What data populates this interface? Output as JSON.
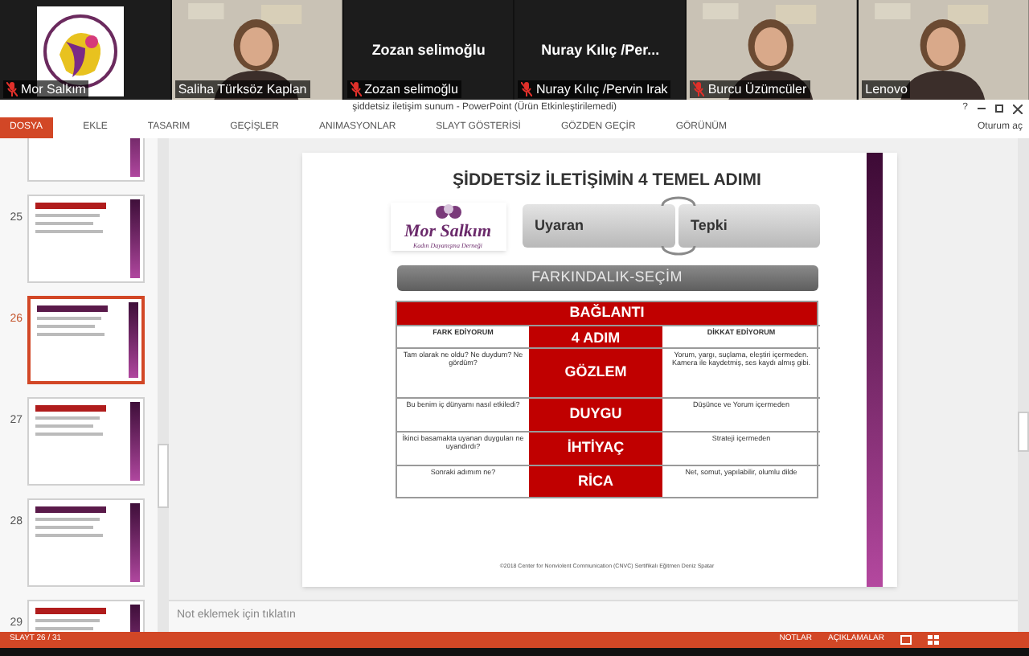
{
  "participants": [
    {
      "name": "Mor Salkım",
      "kind": "logo",
      "muted": true
    },
    {
      "name": "Saliha Türksöz Kaplan",
      "kind": "video",
      "muted": false
    },
    {
      "name": "Zozan selimoğlu",
      "kind": "name",
      "center_name": "Zozan selimoğlu",
      "muted": true
    },
    {
      "name": "Nuray Kılıç /Pervin Irak",
      "kind": "name",
      "center_name": "Nuray  Kılıç  /Per...",
      "muted": true
    },
    {
      "name": "Burcu Üzümcüler",
      "kind": "video",
      "muted": true
    },
    {
      "name": "Lenovo",
      "kind": "video",
      "muted": false
    }
  ],
  "window": {
    "title": "şiddetsiz iletişim sunum - PowerPoint (Ürün Etkinleştirilemedi)",
    "help": "?",
    "sign_in": "Oturum aç"
  },
  "ribbon_tabs": [
    {
      "label": "DOSYA",
      "selected": true
    },
    {
      "label": "EKLE",
      "selected": false
    },
    {
      "label": "TASARIM",
      "selected": false
    },
    {
      "label": "GEÇİŞLER",
      "selected": false
    },
    {
      "label": "ANIMASYONLAR",
      "selected": false
    },
    {
      "label": "SLAYT GÖSTERİSİ",
      "selected": false
    },
    {
      "label": "GÖZDEN GEÇİR",
      "selected": false
    },
    {
      "label": "GÖRÜNÜM",
      "selected": false
    }
  ],
  "thumbnails": [
    {
      "selected": false
    },
    {
      "number": "25",
      "selected": false
    },
    {
      "number": "26",
      "selected": true
    },
    {
      "number": "27",
      "selected": false
    },
    {
      "number": "28",
      "selected": false
    },
    {
      "number": "29",
      "selected": false
    }
  ],
  "slide": {
    "title": "ŞİDDETSİZ İLETİŞİMİN 4 TEMEL ADIMI",
    "logo_name": "Mor Salkım",
    "logo_subtitle": "Kadın Dayanışma Derneği",
    "stimulus": "Uyaran",
    "response": "Tepki",
    "banner": "FARKINDALIK-SEÇİM",
    "table": {
      "header": "BAĞLANTI",
      "columns": [
        "FARK EDİYORUM",
        "4 ADIM",
        "DİKKAT EDİYORUM"
      ],
      "rows": [
        [
          "Tam olarak ne oldu? Ne duydum? Ne gördüm?",
          "GÖZLEM",
          "Yorum, yargı, suçlama, eleştiri içermeden. Kamera ile kaydetmiş, ses kaydı almış gibi."
        ],
        [
          "Bu benim iç dünyamı nasıl etkiledi?",
          "DUYGU",
          "Düşünce ve Yorum içermeden"
        ],
        [
          "İkinci basamakta uyanan duyguları ne uyandırdı?",
          "İHTİYAÇ",
          "Strateji içermeden"
        ],
        [
          "Sonraki adımım ne?",
          "RİCA",
          "Net, somut, yapılabilir, olumlu dilde"
        ]
      ]
    },
    "footer": "©2018 Center for Nonviolent Communication (CNVC) Sertifikalı Eğitmen Deniz Spatar"
  },
  "notes_placeholder": "Not eklemek için tıklatın",
  "status_bar": {
    "slide_counter": "SLAYT 26 / 31",
    "notes": "NOTLAR",
    "comments": "AÇIKLAMALAR"
  }
}
